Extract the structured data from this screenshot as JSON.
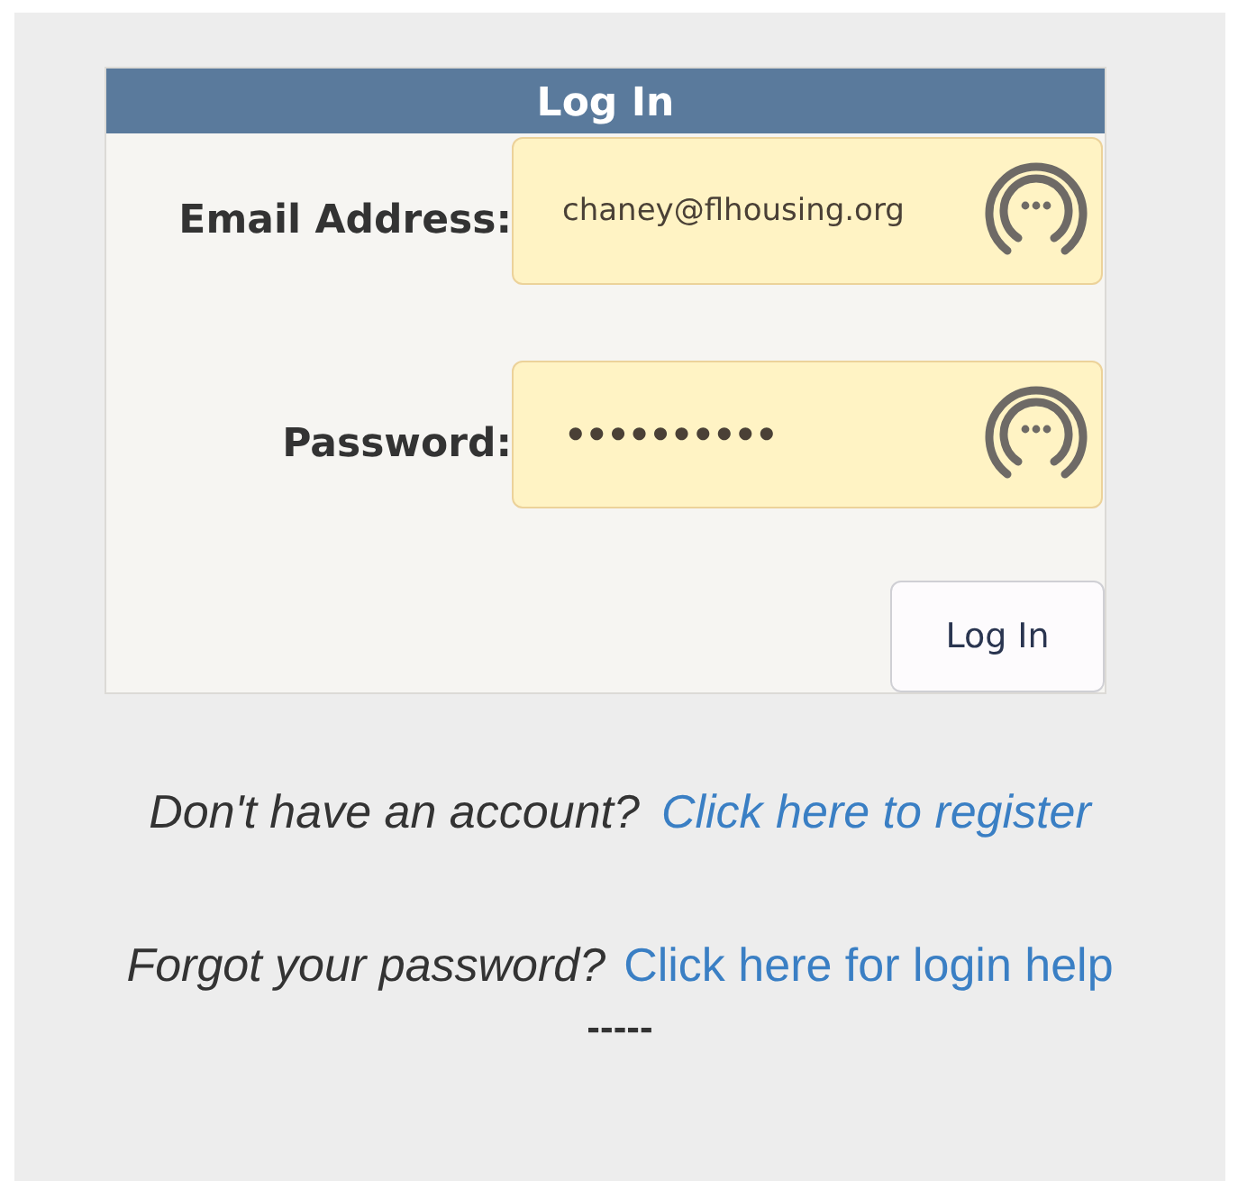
{
  "panel": {
    "title": "Log In",
    "fields": [
      {
        "label": "Email Address:",
        "value": "chaney@flhousing.org",
        "kind": "text"
      },
      {
        "label": "Password:",
        "value": "••••••••••",
        "kind": "password"
      }
    ],
    "button": "Log In"
  },
  "links": [
    {
      "prompt": "Don't have an account?",
      "link": "Click here to register"
    },
    {
      "prompt": "Forgot your password?",
      "link": "Click here for login help"
    }
  ],
  "separator": "-----"
}
